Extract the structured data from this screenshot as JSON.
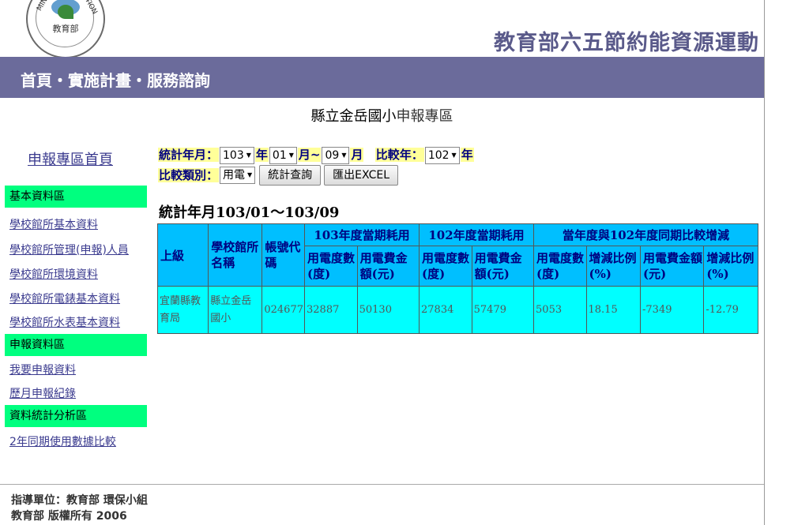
{
  "header": {
    "logo_text": "教育部",
    "logo_side_left": "MINISTRY",
    "logo_side_right": "CATION",
    "campaign_title": "教育部六五節約能資源運動"
  },
  "nav": {
    "home": "首頁",
    "plan": "實施計畫",
    "service": "服務諮詢",
    "separator": "・"
  },
  "page_title": {
    "school": "縣立金岳國小",
    "zone": "申報專區"
  },
  "sidebar": {
    "home_link": "申報專區首頁",
    "sections": [
      {
        "title": "基本資料區",
        "items": [
          "學校館所基本資料",
          "學校館所管理(申報)人員",
          "學校館所環境資料",
          "學校館所電錶基本資料",
          "學校館所水表基本資料"
        ]
      },
      {
        "title": "申報資料區",
        "items": [
          "我要申報資料",
          "歷月申報紀錄"
        ]
      },
      {
        "title": "資料統計分析區",
        "items": [
          "2年同期使用數據比較"
        ]
      }
    ]
  },
  "form": {
    "stat_label": "統計年月：",
    "year_value": "103",
    "year_suffix": "年",
    "month_from": "01",
    "month_suffix1": "月~",
    "month_to": "09",
    "month_suffix2": "月",
    "compare_year_label": "比較年：",
    "compare_year_value": "102",
    "compare_year_suffix": "年",
    "category_label": "比較類別：",
    "category_value": "用電",
    "query_button": "統計查詢",
    "export_button": "匯出EXCEL"
  },
  "stats_heading": "統計年月103/01～103/09",
  "table": {
    "col_parent": "上級",
    "col_school": "學校館所名稱",
    "col_account": "帳號代碼",
    "group_current": "103年度當期耗用",
    "group_previous": "102年度當期耗用",
    "group_diff": "當年度與102年度同期比較增減",
    "sub_headers": [
      "用電度數(度)",
      "用電費金額(元)",
      "用電度數(度)",
      "用電費金額(元)",
      "用電度數(度)",
      "增減比例(%)",
      "用電費金額(元)",
      "增減比例(%)"
    ],
    "rows": [
      {
        "parent": "宜蘭縣教育局",
        "school": "縣立金岳國小",
        "account": "024677",
        "values": [
          "32887",
          "50130",
          "27834",
          "57479",
          "5053",
          "18.15",
          "-7349",
          "-12.79"
        ]
      }
    ]
  },
  "footer": {
    "line1": "指導單位：教育部 環保小組",
    "line2": "教育部 版權所有 2006"
  }
}
